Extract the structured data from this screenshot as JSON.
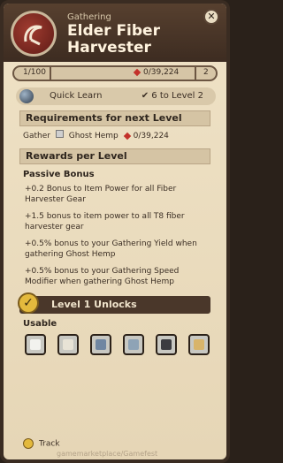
{
  "header": {
    "category": "Gathering",
    "title": "Elder Fiber Harvester"
  },
  "progress": {
    "current": "1/100",
    "points": "0/39,224",
    "next": "2"
  },
  "quick_learn": {
    "label": "Quick Learn",
    "level": "6 to Level 2"
  },
  "requirements": {
    "heading": "Requirements for next Level",
    "gather_label": "Gather",
    "item": "Ghost Hemp",
    "amount": "0/39,224"
  },
  "rewards": {
    "heading": "Rewards per Level",
    "subheading": "Passive Bonus",
    "bonuses": [
      "+0.2 Bonus to Item Power for all Fiber Harvester Gear",
      "+1.5 bonus to item power to all T8 fiber harvester gear",
      "+0.5% bonus to your Gathering Yield when gathering  Ghost Hemp",
      "+0.5% bonus to your Gathering Speed Modifier when gathering  Ghost Hemp"
    ]
  },
  "unlocks": {
    "heading": "Level 1 Unlocks",
    "usable_label": "Usable"
  },
  "footer": {
    "track_label": "Track",
    "watermark": "gamemarketplace/Gamefest"
  },
  "colors": {
    "accent": "#e3b93d",
    "header_bg": "#4a372a"
  }
}
